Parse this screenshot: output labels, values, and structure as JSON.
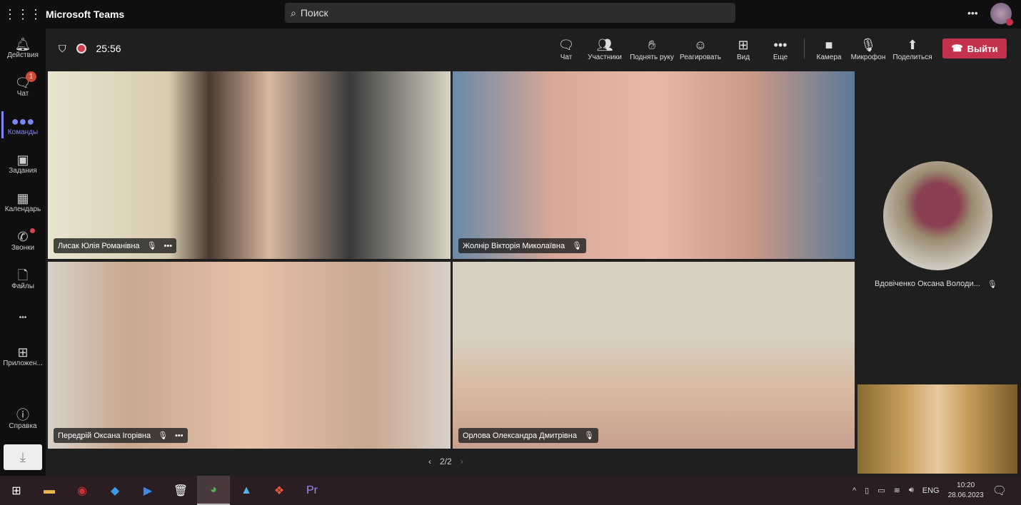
{
  "app": {
    "title": "Microsoft Teams",
    "search_placeholder": "Поиск"
  },
  "rail": [
    {
      "label": "Действия",
      "icon": "🔔"
    },
    {
      "label": "Чат",
      "icon": "💬",
      "badge": "1"
    },
    {
      "label": "Команды",
      "icon": "👥",
      "active": true
    },
    {
      "label": "Задания",
      "icon": "🎒"
    },
    {
      "label": "Календарь",
      "icon": "📅"
    },
    {
      "label": "Звонки",
      "icon": "📞"
    },
    {
      "label": "Файлы",
      "icon": "📄"
    },
    {
      "label": "•••",
      "icon": ""
    },
    {
      "label": "Приложен...",
      "icon": "▦"
    },
    {
      "label": "Справка",
      "icon": "?"
    }
  ],
  "meeting": {
    "timer": "25:56",
    "controls": [
      "Чат",
      "Участники",
      "Поднять руку",
      "Реагировать",
      "Вид",
      "Еще",
      "Камера",
      "Микрофон",
      "Поделиться"
    ],
    "leave": "Выйти",
    "pager": "2/2"
  },
  "participants": [
    {
      "name": "Лисак Юлія Романівна",
      "more": "•••"
    },
    {
      "name": "Жолнір Вікторія Миколаївна"
    },
    {
      "name": "Передрій Оксана Ігорівна",
      "more": "•••"
    },
    {
      "name": "Орлова Олександра Дмитрівна"
    },
    {
      "name": "Вдовіченко Оксана Володи..."
    }
  ],
  "taskbar": {
    "lang": "ENG",
    "time": "10:20",
    "date": "28.06.2023"
  },
  "colors": {
    "accent": "#7f85f5",
    "leave": "#c4314b"
  }
}
